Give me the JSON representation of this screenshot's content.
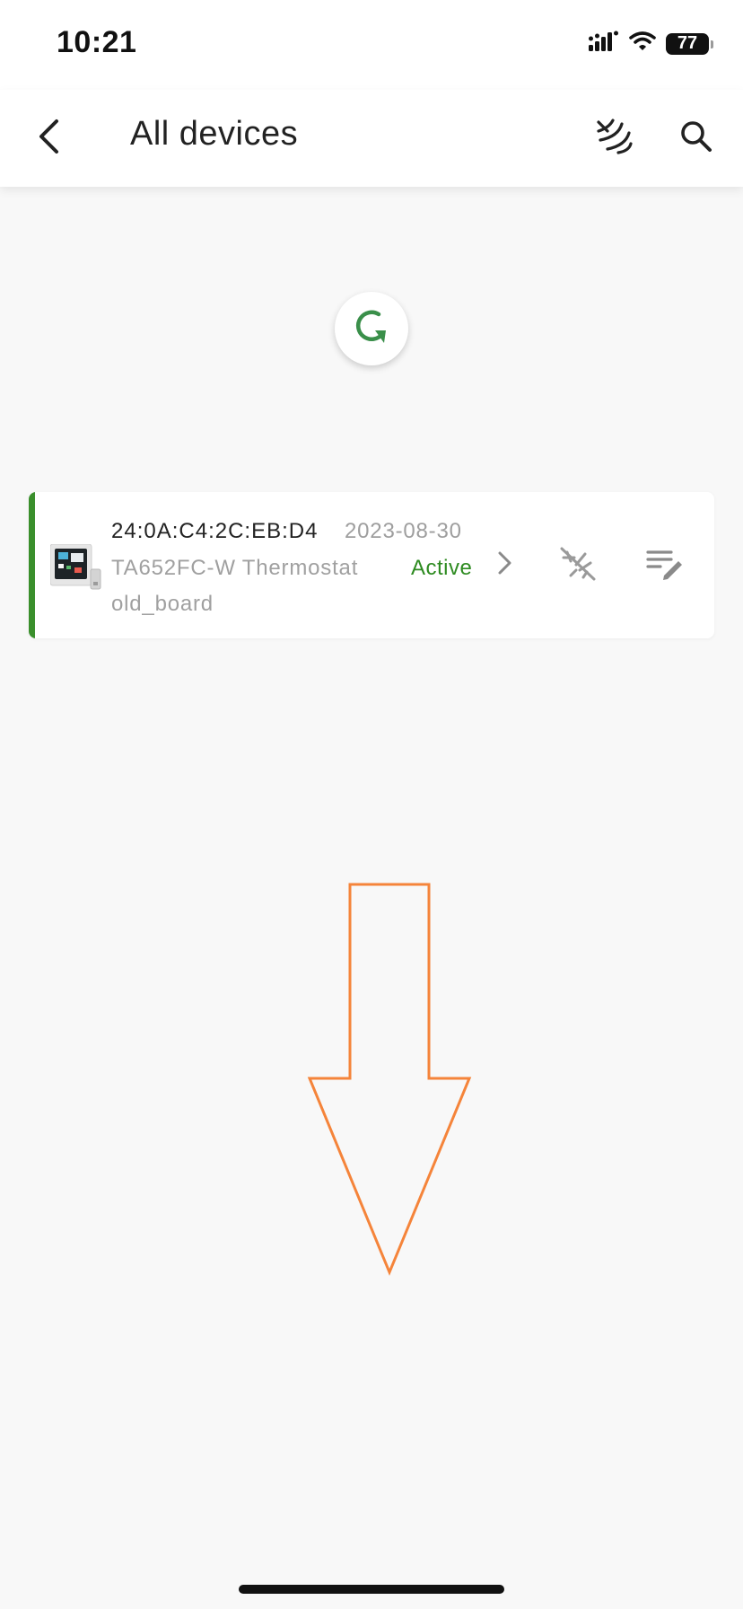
{
  "status_bar": {
    "time": "10:21",
    "battery_level": "77",
    "icons": [
      "signal-icon",
      "wifi-icon",
      "battery-icon"
    ]
  },
  "app_bar": {
    "title": "All devices",
    "icons": [
      "back-arrow-icon",
      "nfc-icon",
      "search-icon"
    ]
  },
  "refresh": {
    "icon": "refresh-icon",
    "color": "#3a8f4a"
  },
  "devices": [
    {
      "mac": "24:0A:C4:2C:EB:D4",
      "date": "2023-08-30",
      "model": "TA652FC-W Thermostat",
      "name": "old_board",
      "status": "Active",
      "accent_color": "#3a8f2c",
      "status_color": "#2e8b21",
      "icons": [
        "thermostat-thumbnail-icon",
        "chevron-right-icon",
        "unlink-icon",
        "edit-icon"
      ]
    }
  ],
  "annotation": {
    "shape": "down-arrow",
    "color": "#f5843a"
  }
}
